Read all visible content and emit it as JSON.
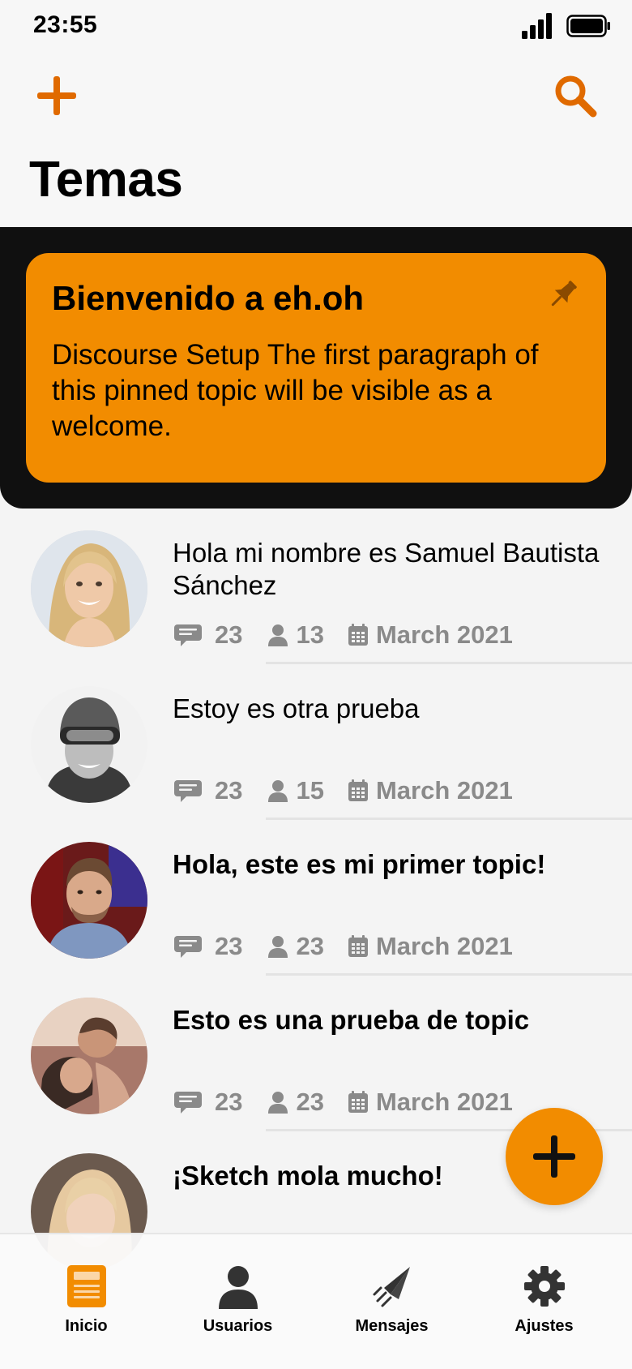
{
  "status_bar": {
    "time": "23:55"
  },
  "header": {
    "title": "Temas",
    "add_icon": "plus-icon",
    "search_icon": "search-icon"
  },
  "pinned": {
    "title": "Bienvenido a eh.oh",
    "body": "Discourse Setup The first paragraph of this pinned topic will be visible as a welcome.",
    "icon": "pin-icon"
  },
  "topics": [
    {
      "title": "Hola mi nombre es Samuel Bautista Sánchez",
      "bold": false,
      "replies": "23",
      "users": "13",
      "date": "March 2021"
    },
    {
      "title": "Estoy es otra prueba",
      "bold": false,
      "replies": "23",
      "users": "15",
      "date": "March 2021"
    },
    {
      "title": "Hola, este es mi primer topic!",
      "bold": true,
      "replies": "23",
      "users": "23",
      "date": "March 2021"
    },
    {
      "title": "Esto es una prueba de topic",
      "bold": true,
      "replies": "23",
      "users": "23",
      "date": "March 2021"
    },
    {
      "title": "¡Sketch mola mucho!",
      "bold": true,
      "replies": "",
      "users": "",
      "date": ""
    }
  ],
  "tabs": [
    {
      "label": "Inicio",
      "icon": "document-icon",
      "active": true
    },
    {
      "label": "Usuarios",
      "icon": "user-icon",
      "active": false
    },
    {
      "label": "Mensajes",
      "icon": "send-icon",
      "active": false
    },
    {
      "label": "Ajustes",
      "icon": "gear-icon",
      "active": false
    }
  ],
  "colors": {
    "accent": "#f28c00",
    "accent_dark": "#e06a00",
    "meta_gray": "#8a8a8a",
    "pinned_bg": "#101010"
  }
}
